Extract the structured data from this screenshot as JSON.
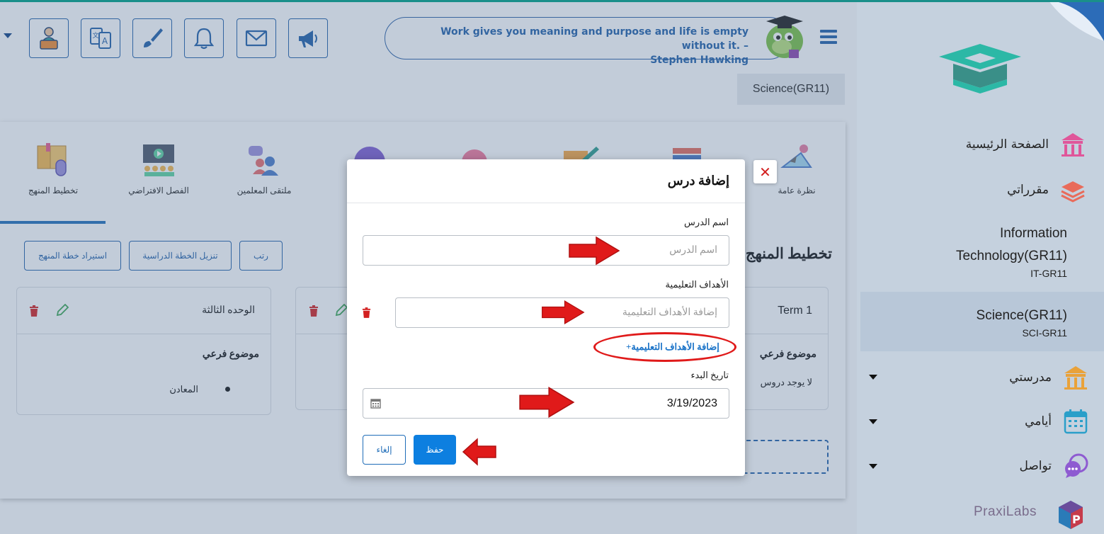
{
  "header": {
    "quote_text": "Work gives you meaning and purpose and life is empty without it. –",
    "quote_author": "Stephen Hawking",
    "current_course": "Science(GR11)",
    "toolbar_icons": [
      "teacher-icon",
      "translate-icon",
      "brush-icon",
      "bell-icon",
      "mail-icon",
      "megaphone-icon"
    ]
  },
  "tabs": [
    {
      "label": "تخطيط المنهج",
      "icon": "curriculum-icon",
      "active": true
    },
    {
      "label": "الفصل الافتراضي",
      "icon": "virtual-class-icon"
    },
    {
      "label": "ملتقى المعلمين",
      "icon": "teachers-forum-icon"
    },
    {
      "label": "نظرة عامة",
      "icon": "overview-icon"
    }
  ],
  "actions": {
    "import_plan": "استيراد خطة المنهج",
    "download_plan": "تنزيل الخطة الدراسية",
    "sort": "رتب"
  },
  "panel_title": "تخطيط المنهج",
  "cards": [
    {
      "title": "الوحده الثالثة",
      "subtitle": "موضوع فرعي",
      "items": [
        "المعادن"
      ]
    },
    {
      "title": "Term 1",
      "subtitle": "موضوع فرعي",
      "empty_text": "لا يوجد دروس"
    }
  ],
  "modal": {
    "title": "إضافة درس",
    "close": "✕",
    "lesson_name_label": "اسم الدرس",
    "lesson_name_placeholder": "اسم الدرس",
    "objectives_label": "الأهداف التعليمية",
    "objectives_placeholder": "إضافة الأهداف التعليمية",
    "add_objective_link": "+إضافة الأهداف التعليمية",
    "start_date_label": "تاريخ البدء",
    "start_date_value": "3/19/2023",
    "save_label": "حفظ",
    "cancel_label": "إلغاء"
  },
  "sidebar": {
    "home": "الصفحة الرئيسية",
    "my_courses": "مقرراتي",
    "courses": [
      {
        "name": "Information Technology(GR11)",
        "code": "IT-GR11"
      },
      {
        "name": "Science(GR11)",
        "code": "SCI-GR11",
        "active": true
      }
    ],
    "my_school": "مدرستي",
    "my_days": "أيامي",
    "communication": "تواصل",
    "brand": "PraxiLabs"
  },
  "colors": {
    "accent": "#1f5ea8",
    "primary_button": "#0d7fe0",
    "annotation_red": "#e01a1a",
    "sidebar_bg": "#c5d1de"
  }
}
